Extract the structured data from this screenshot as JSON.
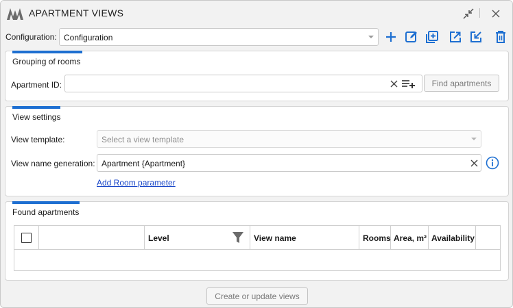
{
  "window": {
    "title": "APARTMENT VIEWS",
    "logo_icon": "app-logo-icon",
    "collapse_icon": "collapse-arrows-icon",
    "close_icon": "close-icon"
  },
  "config": {
    "label": "Configuration:",
    "selected": "Configuration",
    "actions": [
      {
        "name": "add-configuration-button",
        "icon": "plus-icon"
      },
      {
        "name": "edit-configuration-button",
        "icon": "edit-icon"
      },
      {
        "name": "duplicate-configuration-button",
        "icon": "duplicate-icon"
      },
      {
        "name": "export-configuration-button",
        "icon": "export-icon"
      },
      {
        "name": "import-configuration-button",
        "icon": "import-icon"
      },
      {
        "name": "delete-configuration-button",
        "icon": "trash-icon"
      }
    ],
    "accent_color": "#1e6fd1"
  },
  "grouping": {
    "title": "Grouping of rooms",
    "apartment_id_label": "Apartment ID:",
    "apartment_id_value": "",
    "find_button": "Find apartments"
  },
  "view_settings": {
    "title": "View settings",
    "template_label": "View template:",
    "template_placeholder": "Select a view template",
    "name_generation_label": "View name generation:",
    "name_generation_value": "Apartment {Apartment}",
    "add_param_link": "Add Room parameter"
  },
  "found": {
    "title": "Found apartments",
    "columns": [
      "",
      "",
      "Level",
      "View name",
      "Rooms",
      "Area, m²",
      "Availability",
      ""
    ],
    "rows": []
  },
  "footer": {
    "create_button": "Create or update views"
  }
}
